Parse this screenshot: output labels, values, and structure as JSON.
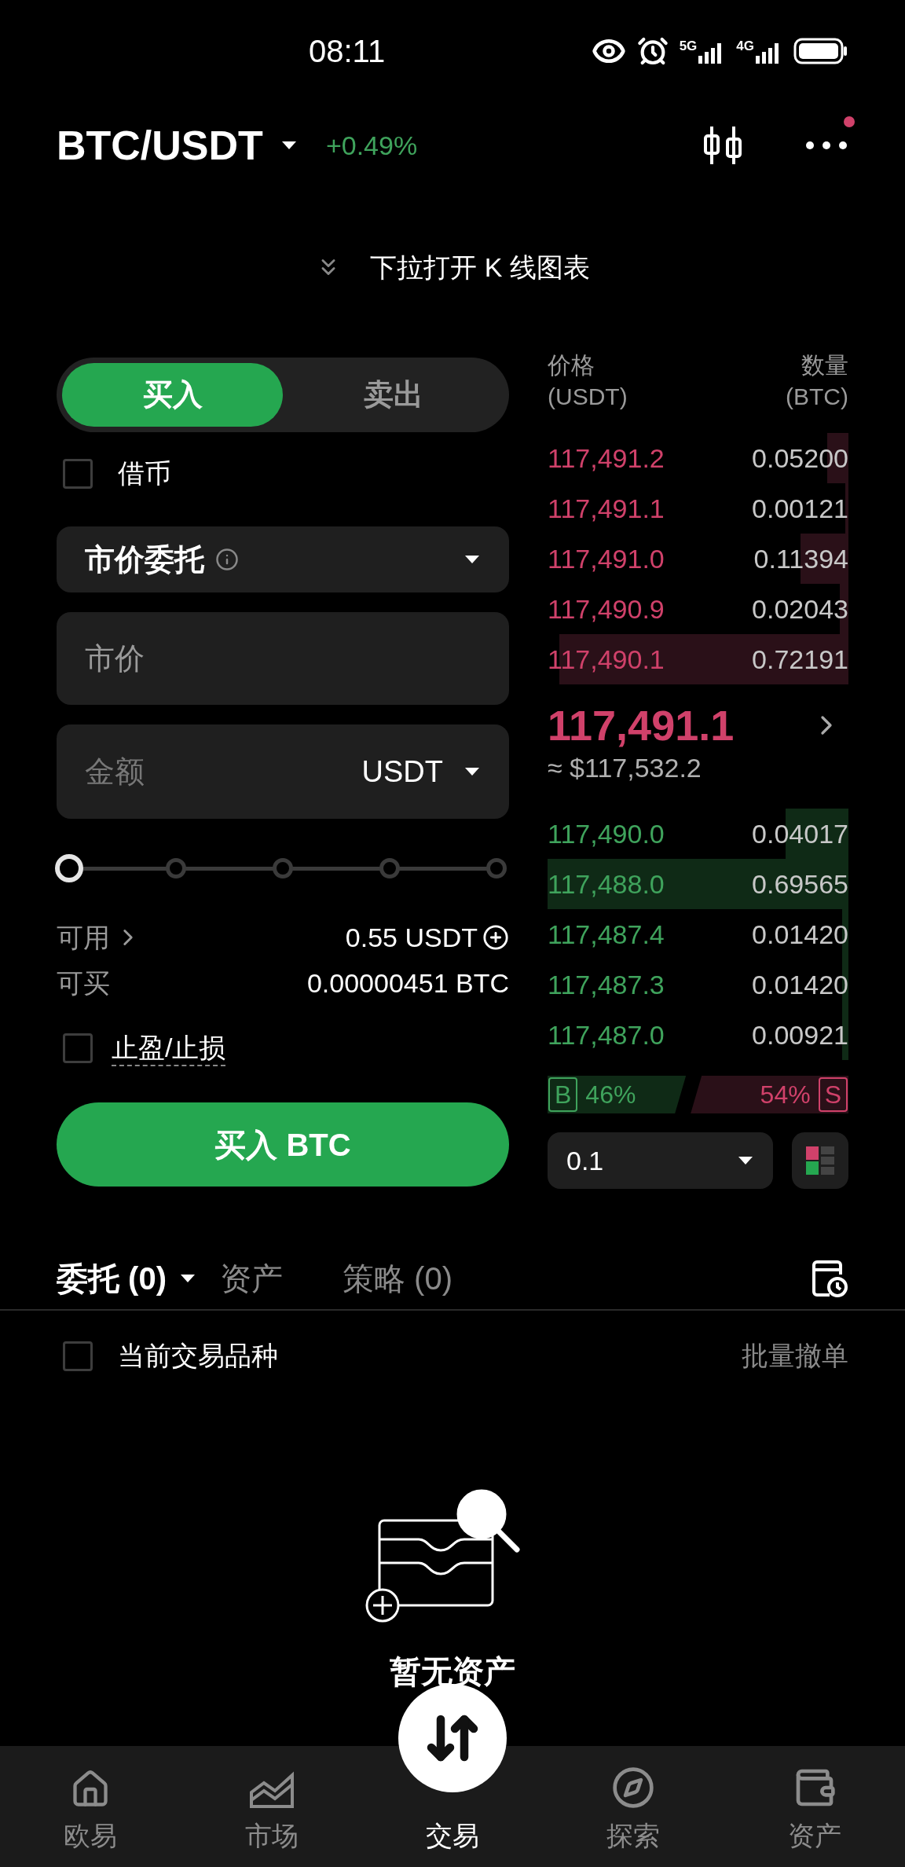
{
  "status_bar": {
    "time": "08:11",
    "networks": [
      "5G",
      "4G"
    ]
  },
  "header": {
    "pair": "BTC/USDT",
    "change": "+0.49%",
    "notification_dot": true
  },
  "chart_pull": {
    "label": "下拉打开 K 线图表"
  },
  "side_tabs": [
    {
      "label": "买入",
      "selected": true
    },
    {
      "label": "卖出",
      "selected": false
    }
  ],
  "borrow": {
    "label": "借币",
    "checked": false
  },
  "order_type": {
    "value": "市价委托"
  },
  "price_field": {
    "value": "市价"
  },
  "amount_field": {
    "placeholder": "金额",
    "unit": "USDT"
  },
  "slider": {
    "level": 0
  },
  "available": {
    "label": "可用",
    "value": "0.55 USDT"
  },
  "buyable": {
    "label": "可买",
    "value": "0.00000451 BTC"
  },
  "tp_sl": {
    "label": "止盈/止损",
    "checked": false
  },
  "submit": {
    "label": "买入 BTC"
  },
  "order_book": {
    "price_header": [
      "价格",
      "(USDT)"
    ],
    "qty_header": [
      "数量",
      "(BTC)"
    ],
    "asks": [
      {
        "price": "117,491.2",
        "qty": "0.05200"
      },
      {
        "price": "117,491.1",
        "qty": "0.00121"
      },
      {
        "price": "117,491.0",
        "qty": "0.11394"
      },
      {
        "price": "117,490.9",
        "qty": "0.02043"
      },
      {
        "price": "117,490.1",
        "qty": "0.72191"
      }
    ],
    "last_price": "117,491.1",
    "last_price_usd": "≈ $117,532.2",
    "bids": [
      {
        "price": "117,490.0",
        "qty": "0.04017"
      },
      {
        "price": "117,488.0",
        "qty": "0.69565"
      },
      {
        "price": "117,487.4",
        "qty": "0.01420"
      },
      {
        "price": "117,487.3",
        "qty": "0.01420"
      },
      {
        "price": "117,487.0",
        "qty": "0.00921"
      }
    ],
    "buy_ratio": {
      "label": "B",
      "value": "46%"
    },
    "sell_ratio": {
      "label": "S",
      "value": "54%"
    },
    "depth": "0.1"
  },
  "order_tabs": [
    {
      "label": "委托 (0)",
      "selected": true
    },
    {
      "label": "资产",
      "selected": false
    },
    {
      "label": "策略 (0)",
      "selected": false
    }
  ],
  "filter": {
    "label": "当前交易品种",
    "checked": false
  },
  "cancel_all": "批量撤单",
  "empty": {
    "message": "暂无资产"
  },
  "nav": [
    {
      "label": "欧易",
      "kind": "home",
      "selected": false
    },
    {
      "label": "市场",
      "kind": "market",
      "selected": false
    },
    {
      "label": "交易",
      "kind": "trade",
      "selected": true
    },
    {
      "label": "探索",
      "kind": "explore",
      "selected": false
    },
    {
      "label": "资产",
      "kind": "assets",
      "selected": false
    }
  ]
}
